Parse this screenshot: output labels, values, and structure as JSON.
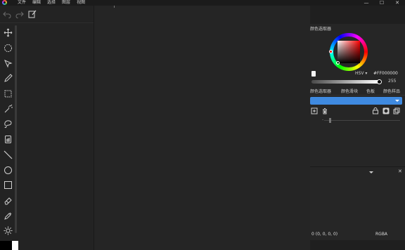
{
  "menu": {
    "items": [
      "文件",
      "编辑",
      "选择",
      "图层",
      "视图"
    ]
  },
  "window_controls": {
    "minimize": "—",
    "maximize": "☐",
    "close": "✕"
  },
  "toolbar": {
    "undo_icon": "undo-icon",
    "redo_icon": "redo-icon",
    "edit_icon": "edit-icon",
    "tools": [
      "move-icon",
      "lasso-icon",
      "select-icon",
      "pencil-icon",
      "rect-select-icon",
      "magic-wand-icon",
      "free-lasso-icon",
      "fill-icon",
      "line-icon",
      "ellipse-icon",
      "rectangle-icon",
      "eraser-icon",
      "eyedropper-icon",
      "brightness-icon"
    ]
  },
  "colors": {
    "primary": "#000000",
    "secondary": "#FFFFFF",
    "accent": "#3f8ae0"
  },
  "color_panel": {
    "title": "颜色选取器",
    "mode": "HSV",
    "hex": "#FF000000",
    "alpha": "255"
  },
  "tabs": [
    "颜色选取器",
    "颜色滑块",
    "色板",
    "颜色样品"
  ],
  "status": {
    "pixel": "0   (0, 0, 0, 0)",
    "format": "RGBA"
  }
}
